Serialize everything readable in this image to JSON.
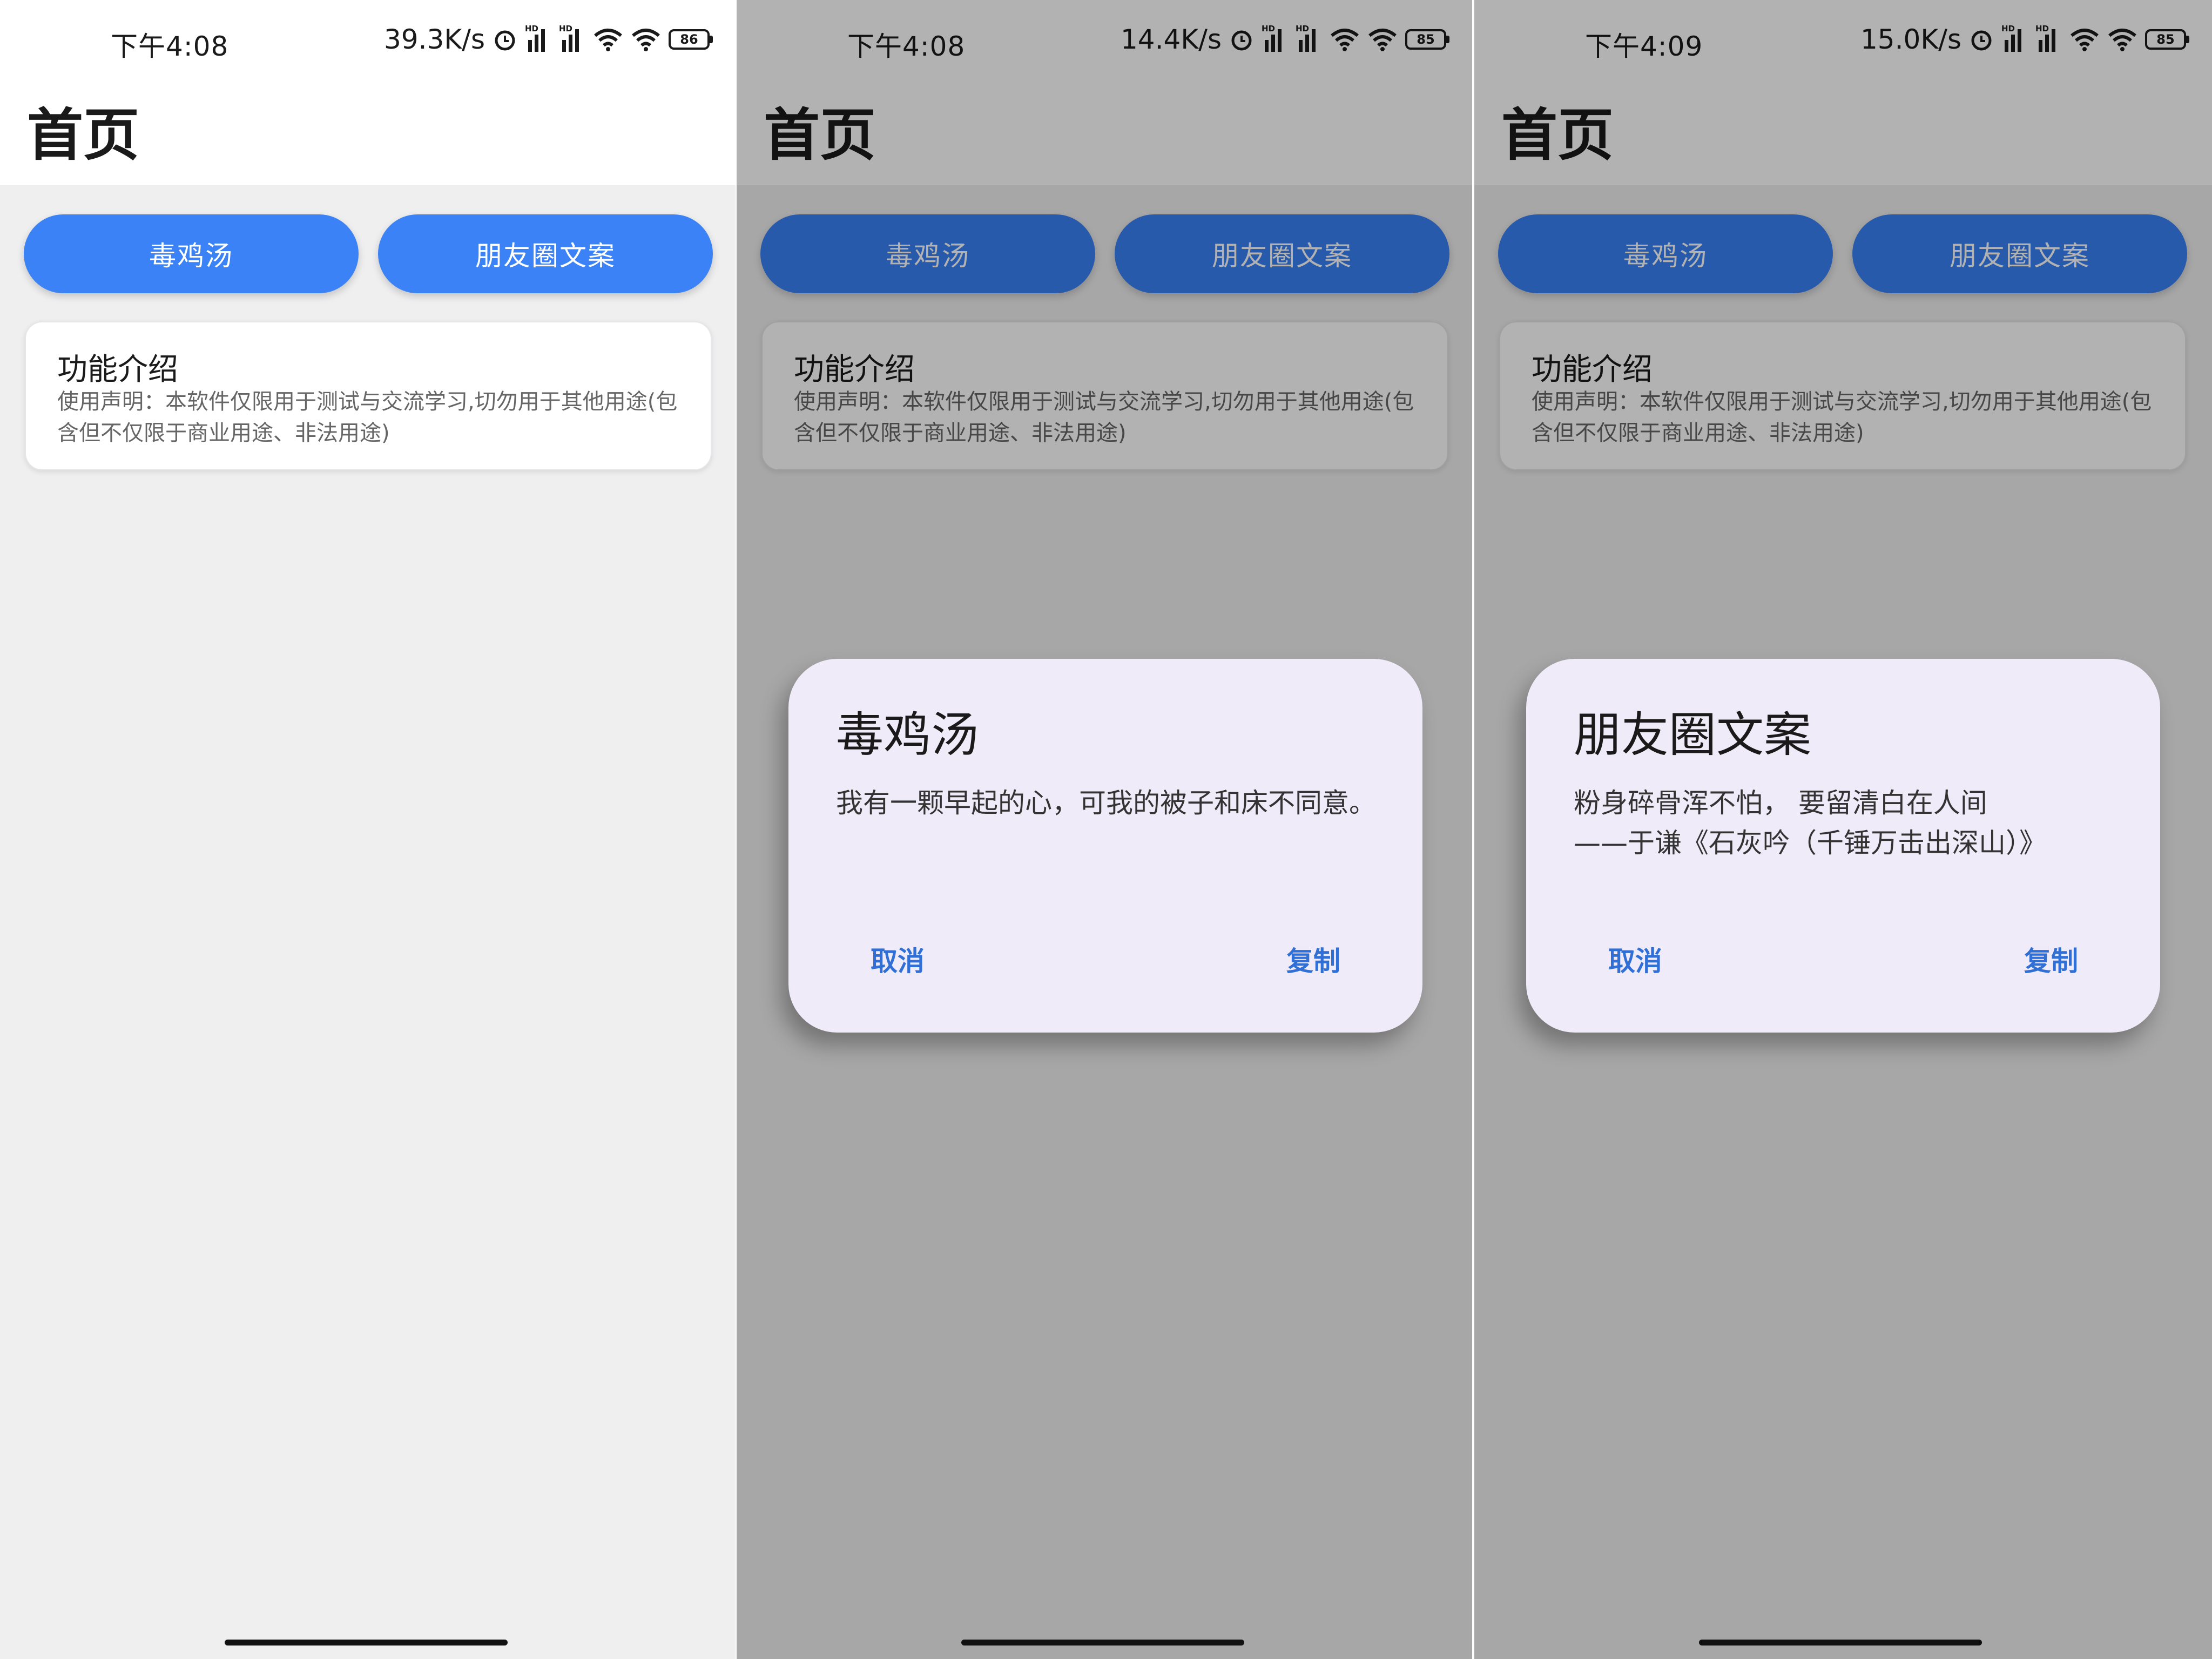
{
  "panels": [
    {
      "status": {
        "time": "下午4:08",
        "speed": "39.3K/s",
        "battery": "86"
      },
      "title": "首页",
      "buttons": {
        "soup": "毒鸡汤",
        "moments": "朋友圈文案"
      },
      "card": {
        "title": "功能介绍",
        "text": "使用声明：本软件仅限用于测试与交流学习,切勿用于其他用途(包含但不仅限于商业用途、非法用途)"
      }
    },
    {
      "status": {
        "time": "下午4:08",
        "speed": "14.4K/s",
        "battery": "85"
      },
      "title": "首页",
      "buttons": {
        "soup": "毒鸡汤",
        "moments": "朋友圈文案"
      },
      "card": {
        "title": "功能介绍",
        "text": "使用声明：本软件仅限用于测试与交流学习,切勿用于其他用途(包含但不仅限于商业用途、非法用途)"
      },
      "dialog": {
        "title": "毒鸡汤",
        "content": "我有一颗早起的心，可我的被子和床不同意。",
        "cancel": "取消",
        "copy": "复制"
      }
    },
    {
      "status": {
        "time": "下午4:09",
        "speed": "15.0K/s",
        "battery": "85"
      },
      "title": "首页",
      "buttons": {
        "soup": "毒鸡汤",
        "moments": "朋友圈文案"
      },
      "card": {
        "title": "功能介绍",
        "text": "使用声明：本软件仅限用于测试与交流学习,切勿用于其他用途(包含但不仅限于商业用途、非法用途)"
      },
      "dialog": {
        "title": "朋友圈文案",
        "content_line1": "粉身碎骨浑不怕， 要留清白在人间",
        "content_line2": "——于谦《石灰吟（千锤万击出深山）》",
        "cancel": "取消",
        "copy": "复制"
      }
    }
  ],
  "colors": {
    "primary": "#3a82f6",
    "dialog_bg": "#efebf8",
    "dialog_action": "#2f6fd6",
    "page_bg": "#efeff0",
    "scrim": "rgba(0,0,0,0.30)"
  },
  "icons": [
    "alarm-icon",
    "signal-icon",
    "wifi-icon",
    "battery-icon"
  ]
}
